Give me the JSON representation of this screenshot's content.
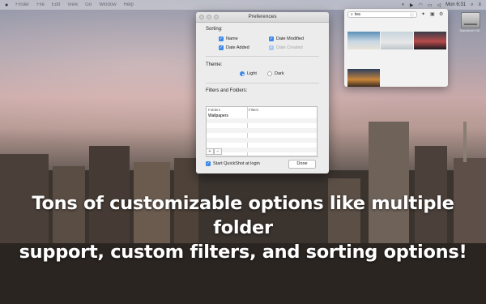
{
  "menubar": {
    "menus": [
      "Finder",
      "File",
      "Edit",
      "View",
      "Go",
      "Window",
      "Help"
    ],
    "clock": "Mon 6:31",
    "status_icons": [
      "quickshot-icon",
      "play-icon",
      "wifi-icon",
      "battery-icon",
      "volume-icon"
    ]
  },
  "prefs": {
    "title": "Preferences",
    "sorting_label": "Sorting:",
    "name_label": "Name",
    "date_added_label": "Date Added",
    "date_modified_label": "Date Modified",
    "date_created_label": "Date Created",
    "theme_label": "Theme:",
    "light_label": "Light",
    "dark_label": "Dark",
    "filters_label": "Filters and Folders:",
    "col_folders": "Folders",
    "col_filters": "Filters",
    "folder_row": "Wallpapers",
    "plus": "+",
    "minus": "−",
    "start_login_label": "Start QuickShot at login",
    "done_label": "Done"
  },
  "quickshot": {
    "search_value": "tea",
    "icons": [
      "sparkle-icon",
      "folder-icon",
      "gear-icon"
    ]
  },
  "desktop": {
    "drive_label": "Macintosh HD"
  },
  "caption": {
    "line1": "Tons of customizable options like multiple folder",
    "line2": "support, custom filters, and sorting options!"
  },
  "colors": {
    "accent": "#3b87e8"
  }
}
